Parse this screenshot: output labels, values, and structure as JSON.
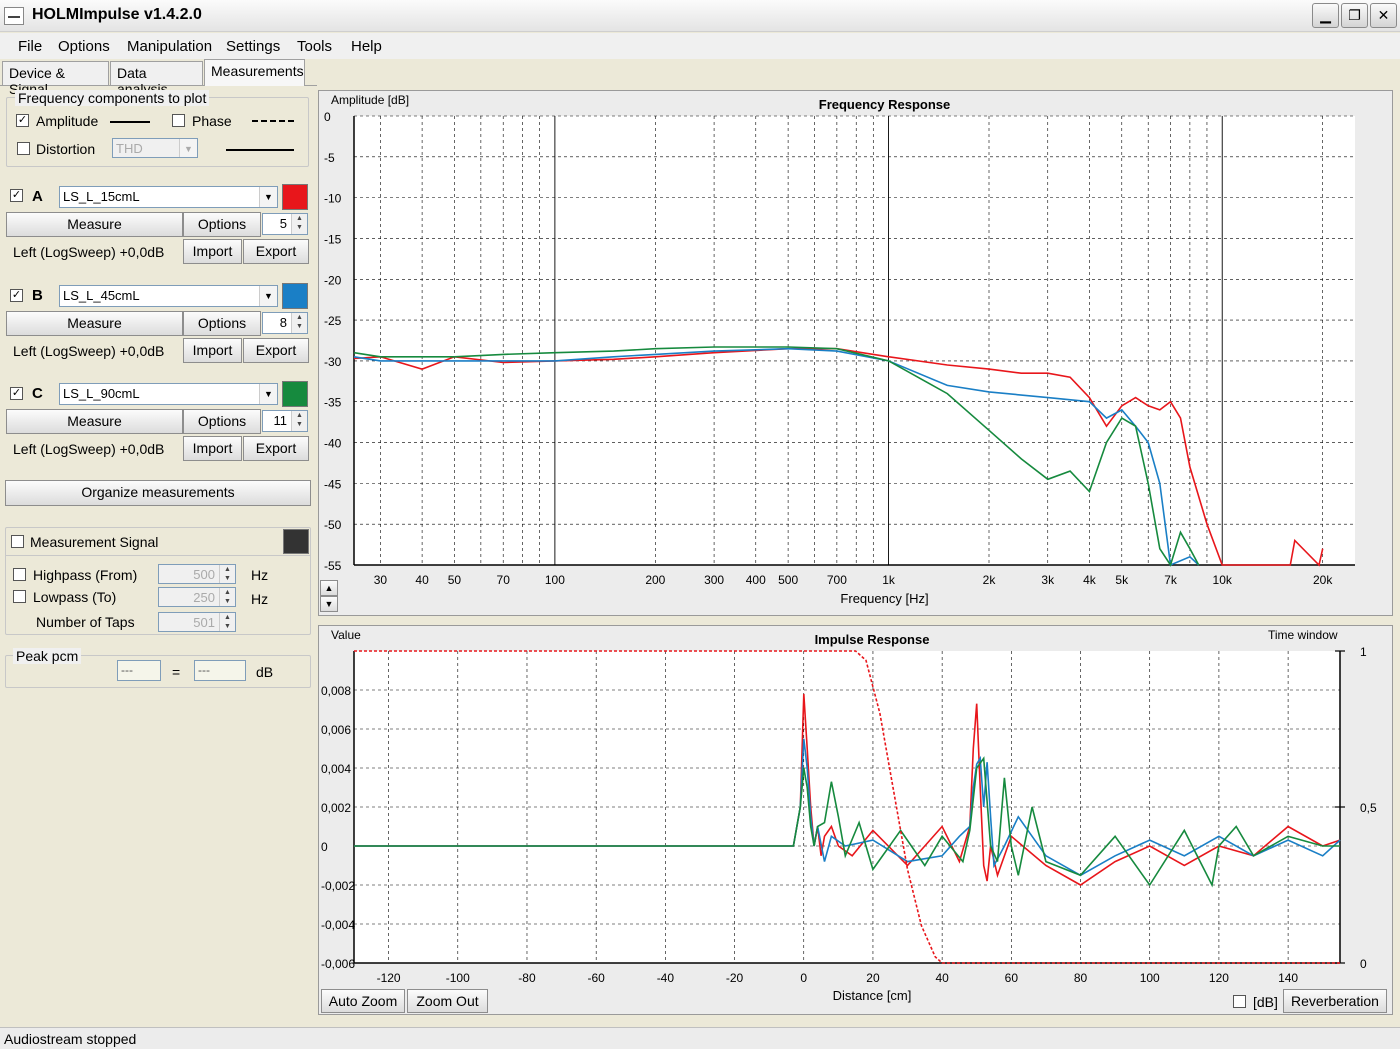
{
  "window": {
    "title": "HOLMImpulse  v1.4.2.0",
    "min_glyph": "▁",
    "max_glyph": "❐",
    "close_glyph": "✕"
  },
  "menu": [
    "File",
    "Options",
    "Manipulation",
    "Settings",
    "Tools",
    "Help"
  ],
  "tabs": [
    "Device & Signal",
    "Data analysis",
    "Measurements"
  ],
  "freq_components": {
    "title": "Frequency components to plot",
    "amplitude": {
      "label": "Amplitude",
      "checked": true
    },
    "phase": {
      "label": "Phase",
      "checked": false
    },
    "distortion": {
      "label": "Distortion",
      "checked": false,
      "value": "THD"
    }
  },
  "measurements": [
    {
      "letter": "A",
      "name": "LS_L_15cmL",
      "color": "#e8161b",
      "checked": true,
      "count": "5",
      "info": "Left (LogSweep) +0,0dB"
    },
    {
      "letter": "B",
      "name": "LS_L_45cmL",
      "color": "#1a7fc6",
      "checked": true,
      "count": "8",
      "info": "Left (LogSweep) +0,0dB"
    },
    {
      "letter": "C",
      "name": "LS_L_90cmL",
      "color": "#168a3e",
      "checked": true,
      "count": "11",
      "info": "Left (LogSweep) +0,0dB"
    }
  ],
  "buttons": {
    "measure": "Measure",
    "options": "Options",
    "import": "Import",
    "export": "Export",
    "organize": "Organize measurements"
  },
  "signal": {
    "label": "Measurement Signal",
    "checked": false,
    "color": "#333333",
    "highpass": {
      "label": "Highpass (From)",
      "value": "500",
      "unit": "Hz"
    },
    "lowpass": {
      "label": "Lowpass (To)",
      "value": "250",
      "unit": "Hz"
    },
    "taps": {
      "label": "Number of Taps",
      "value": "501"
    }
  },
  "peak": {
    "title": "Peak pcm",
    "left": "---",
    "equals": "=",
    "right": "---",
    "unit": "dB"
  },
  "status": "Audiostream stopped",
  "impulse_controls": {
    "auto_zoom": "Auto Zoom",
    "zoom_out": "Zoom Out",
    "db_label": "[dB]",
    "reverberation": "Reverberation"
  },
  "chart_data": [
    {
      "type": "line",
      "title": "Frequency Response",
      "xlabel": "Frequency [Hz]",
      "ylabel": "Amplitude [dB]",
      "xscale": "log",
      "xlim": [
        25,
        25000
      ],
      "ylim": [
        -55,
        0
      ],
      "grid": true,
      "xticks": [
        {
          "v": 30,
          "l": "30"
        },
        {
          "v": 40,
          "l": "40"
        },
        {
          "v": 50,
          "l": "50"
        },
        {
          "v": 70,
          "l": "70"
        },
        {
          "v": 100,
          "l": "100"
        },
        {
          "v": 200,
          "l": "200"
        },
        {
          "v": 300,
          "l": "300"
        },
        {
          "v": 400,
          "l": "400"
        },
        {
          "v": 500,
          "l": "500"
        },
        {
          "v": 700,
          "l": "700"
        },
        {
          "v": 1000,
          "l": "1k"
        },
        {
          "v": 2000,
          "l": "2k"
        },
        {
          "v": 3000,
          "l": "3k"
        },
        {
          "v": 4000,
          "l": "4k"
        },
        {
          "v": 5000,
          "l": "5k"
        },
        {
          "v": 7000,
          "l": "7k"
        },
        {
          "v": 10000,
          "l": "10k"
        },
        {
          "v": 20000,
          "l": "20k"
        }
      ],
      "yticks": [
        0,
        -5,
        -10,
        -15,
        -20,
        -25,
        -30,
        -35,
        -40,
        -45,
        -50,
        -55
      ],
      "series": [
        {
          "name": "LS_L_15cmL",
          "color": "#e8161b",
          "x": [
            25,
            30,
            40,
            50,
            70,
            100,
            150,
            200,
            300,
            500,
            700,
            1000,
            1500,
            2000,
            2500,
            3000,
            3500,
            4000,
            4500,
            5000,
            5500,
            6000,
            6500,
            7000,
            7500,
            8000,
            9000,
            10000,
            10500,
            16000,
            16500,
            19500,
            20000
          ],
          "y": [
            -29.7,
            -29.5,
            -31,
            -29.5,
            -30.2,
            -30,
            -29.8,
            -29.5,
            -29,
            -28.5,
            -28.5,
            -29.5,
            -30.5,
            -31,
            -31.5,
            -31.5,
            -32,
            -34.5,
            -38,
            -35.5,
            -34.5,
            -35.5,
            -36,
            -35,
            -37,
            -43,
            -50,
            -55,
            -55,
            -55,
            -52,
            -55,
            -53
          ]
        },
        {
          "name": "LS_L_45cmL",
          "color": "#1a7fc6",
          "x": [
            25,
            30,
            40,
            50,
            70,
            100,
            150,
            200,
            300,
            500,
            700,
            1000,
            1500,
            2000,
            3000,
            4000,
            4500,
            5000,
            5500,
            6000,
            6500,
            7000,
            8000,
            8500
          ],
          "y": [
            -29.5,
            -30,
            -30,
            -30,
            -30,
            -30,
            -29.5,
            -29.2,
            -28.8,
            -28.5,
            -28.8,
            -30,
            -33,
            -33.8,
            -34.5,
            -35,
            -37,
            -36,
            -38,
            -40,
            -45,
            -55,
            -54,
            -55
          ]
        },
        {
          "name": "LS_L_90cmL",
          "color": "#168a3e",
          "x": [
            25,
            30,
            40,
            50,
            70,
            100,
            150,
            200,
            300,
            500,
            700,
            1000,
            1500,
            2000,
            2500,
            3000,
            3500,
            4000,
            4500,
            5000,
            5500,
            6000,
            6500,
            7000,
            7500,
            8000,
            8500
          ],
          "y": [
            -29,
            -29.5,
            -29.5,
            -29.5,
            -29.2,
            -29,
            -28.8,
            -28.5,
            -28.3,
            -28.3,
            -28.5,
            -30,
            -34,
            -38.5,
            -42,
            -44.5,
            -43.5,
            -46,
            -40,
            -37,
            -38,
            -45,
            -53,
            -55,
            -51,
            -53,
            -55
          ]
        }
      ]
    },
    {
      "type": "line",
      "title": "Impulse Response",
      "xlabel": "Distance [cm]",
      "ylabel": "Value",
      "y2label": "Time window",
      "xlim": [
        -130,
        155
      ],
      "ylim": [
        -0.006,
        0.01
      ],
      "y2lim": [
        0,
        1
      ],
      "grid": true,
      "xticks": [
        -120,
        -100,
        -80,
        -60,
        -40,
        -20,
        0,
        20,
        40,
        60,
        80,
        100,
        120,
        140
      ],
      "yticks": [
        {
          "v": 0.008,
          "l": "0,008"
        },
        {
          "v": 0.006,
          "l": "0,006"
        },
        {
          "v": 0.004,
          "l": "0,004"
        },
        {
          "v": 0.002,
          "l": "0,002"
        },
        {
          "v": 0,
          "l": "0"
        },
        {
          "v": -0.002,
          "l": "-0,002"
        },
        {
          "v": -0.004,
          "l": "-0,004"
        },
        {
          "v": -0.006,
          "l": "-0,006"
        }
      ],
      "y2ticks": [
        {
          "v": 1,
          "l": "1"
        },
        {
          "v": 0.5,
          "l": "0,5"
        },
        {
          "v": 0,
          "l": "0"
        }
      ],
      "series": [
        {
          "name": "LS_L_15cmL",
          "color": "#e8161b",
          "x": [
            -130,
            -3,
            -1,
            0,
            1,
            2,
            3,
            4,
            5,
            6,
            8,
            10,
            14,
            20,
            30,
            40,
            45,
            48,
            49,
            50,
            51,
            52,
            53,
            54,
            56,
            60,
            70,
            80,
            90,
            100,
            110,
            120,
            130,
            140,
            150,
            155
          ],
          "y": [
            0,
            0,
            0.002,
            0.0078,
            0.005,
            0.002,
            0,
            0.001,
            -0.0005,
            0.0005,
            0.001,
            0,
            -0.0005,
            0.0008,
            -0.001,
            0.001,
            -0.0008,
            0.001,
            0.005,
            0.0073,
            0.003,
            -0.001,
            -0.0018,
            0,
            -0.0015,
            0.0005,
            -0.001,
            -0.002,
            -0.0008,
            0,
            -0.001,
            0,
            -0.0005,
            0.001,
            0,
            0.0003
          ]
        },
        {
          "name": "LS_L_45cmL",
          "color": "#1a7fc6",
          "x": [
            -130,
            -3,
            -1,
            0,
            1,
            2,
            3,
            4,
            6,
            8,
            12,
            20,
            30,
            40,
            45,
            48,
            49,
            50,
            51,
            52,
            53,
            54,
            55,
            58,
            62,
            70,
            80,
            90,
            100,
            110,
            120,
            130,
            140,
            150,
            155
          ],
          "y": [
            0,
            0,
            0.002,
            0.0055,
            0.004,
            0.0015,
            0,
            0.001,
            -0.0008,
            0.0005,
            0,
            0.0003,
            -0.0008,
            -0.0005,
            0.0005,
            0.001,
            0.003,
            0.0042,
            0.0045,
            0.002,
            0.0043,
            0.0015,
            -0.001,
            0,
            0.0015,
            -0.0005,
            -0.0015,
            -0.0005,
            0.0003,
            -0.0005,
            0.0005,
            -0.0005,
            0.0003,
            -0.0005,
            0.0003
          ]
        },
        {
          "name": "LS_L_90cmL",
          "color": "#168a3e",
          "x": [
            -130,
            -3,
            -1,
            0,
            1,
            2,
            3,
            4,
            6,
            8,
            10,
            12,
            16,
            20,
            28,
            35,
            40,
            46,
            48,
            50,
            52,
            54,
            56,
            58,
            60,
            62,
            66,
            70,
            80,
            90,
            100,
            110,
            118,
            120,
            125,
            130,
            140,
            150,
            155
          ],
          "y": [
            0,
            0,
            0.002,
            0.004,
            0.003,
            0.001,
            0,
            0.001,
            0.0012,
            0.0033,
            0.0015,
            -0.0005,
            0.0012,
            -0.0012,
            0.0008,
            -0.001,
            0.0005,
            -0.0008,
            0.0008,
            0.004,
            0.0045,
            0,
            -0.0008,
            0.0035,
            0,
            -0.0015,
            0.002,
            -0.0008,
            -0.0015,
            0.0005,
            -0.002,
            0.0008,
            -0.002,
            0,
            0.001,
            -0.0005,
            0.0005,
            0,
            0
          ]
        }
      ],
      "window_series": {
        "name": "Time window",
        "color": "#e8161b",
        "dashed": true,
        "x": [
          -130,
          15,
          18,
          22,
          26,
          30,
          34,
          38,
          40,
          155
        ],
        "y": [
          1,
          1,
          0.97,
          0.8,
          0.55,
          0.3,
          0.12,
          0.02,
          0,
          0
        ]
      }
    }
  ]
}
